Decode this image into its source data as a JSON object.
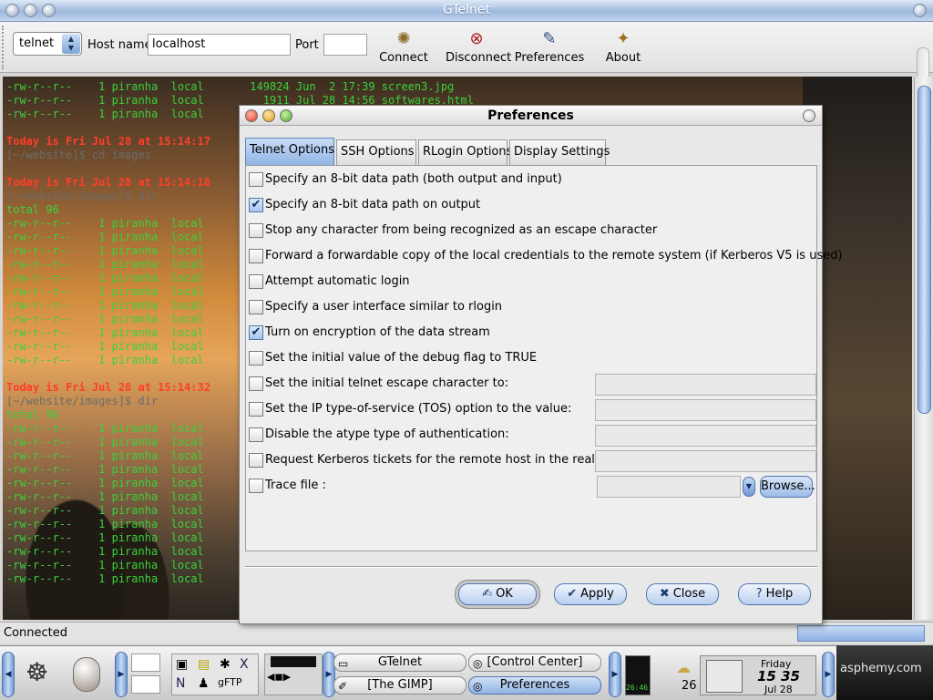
{
  "window": {
    "title": "GTelnet"
  },
  "toolbar": {
    "protocol": "telnet",
    "host_label": "Host name",
    "host_value": "localhost",
    "port_label": "Port",
    "port_value": "",
    "buttons": [
      {
        "label": "Connect",
        "icon": "connect-icon"
      },
      {
        "label": "Disconnect",
        "icon": "disconnect-icon"
      },
      {
        "label": "Preferences",
        "icon": "preferences-icon"
      },
      {
        "label": "About",
        "icon": "about-icon"
      }
    ]
  },
  "terminal": {
    "lines": [
      "-rw-r--r--    1 piranha  local       149824 Jun  2 17:39 screen3.jpg",
      "-rw-r--r--    1 piranha  local         1911 Jul 28 14:56 softwares.html",
      "-rw-r--r--    1 piranha  local",
      "",
      "Today is Fri Jul 28 at 15:14:17",
      "[~/website]$ cd images",
      "",
      "Today is Fri Jul 28 at 15:14:18",
      "[~/website/images]$ dir",
      "total 96",
      "-rw-r--r--    1 piranha  local",
      "-rw-r--r--    1 piranha  local",
      "-rw-r--r--    1 piranha  local",
      "-rw-r--r--    1 piranha  local",
      "-rw-r--r--    1 piranha  local",
      "-rw-r--r--    1 piranha  local",
      "-rw-r--r--    1 piranha  local",
      "-rw-r--r--    1 piranha  local",
      "-rw-r--r--    1 piranha  local",
      "-rw-r--r--    1 piranha  local",
      "-rw-r--r--    1 piranha  local",
      "",
      "Today is Fri Jul 28 at 15:14:32",
      "[~/website/images]$ dir",
      "total 96",
      "-rw-r--r--    1 piranha  local",
      "-rw-r--r--    1 piranha  local",
      "-rw-r--r--    1 piranha  local",
      "-rw-r--r--    1 piranha  local",
      "-rw-r--r--    1 piranha  local",
      "-rw-r--r--    1 piranha  local",
      "-rw-r--r--    1 piranha  local",
      "-rw-r--r--    1 piranha  local",
      "-rw-r--r--    1 piranha  local",
      "-rw-r--r--    1 piranha  local",
      "-rw-r--r--    1 piranha  local",
      "-rw-r--r--    1 piranha  local"
    ]
  },
  "status": {
    "text": "Connected"
  },
  "dialog": {
    "title": "Preferences",
    "tabs": [
      "Telnet Options",
      "SSH Options",
      "RLogin Options",
      "Display Settings"
    ],
    "active_tab": 0,
    "options": [
      {
        "label": "Specify an 8-bit data path (both output and input)",
        "checked": false
      },
      {
        "label": "Specify an 8-bit data path on output",
        "checked": true
      },
      {
        "label": "Stop any character from being  recognized as an escape character",
        "checked": false
      },
      {
        "label": "Forward a forwardable copy of the local credentials to the remote system (if Kerberos V5 is used)",
        "checked": false
      },
      {
        "label": "Attempt automatic login",
        "checked": false
      },
      {
        "label": "Specify a user interface similar to rlogin",
        "checked": false
      },
      {
        "label": "Turn on encryption of the data stream",
        "checked": true
      },
      {
        "label": "Set the initial value of the debug flag to TRUE",
        "checked": false
      },
      {
        "label": "Set  the initial telnet escape character to:",
        "checked": false,
        "field": ""
      },
      {
        "label": "Set the IP type-of-service  (TOS)  option  to the value:",
        "checked": false,
        "field": ""
      },
      {
        "label": "Disable the atype type of authentication:",
        "checked": false,
        "field": ""
      },
      {
        "label": "Request  Kerberos tickets for the remote host in the realm:",
        "checked": false,
        "field": ""
      },
      {
        "label": "Trace file :",
        "checked": false,
        "file": ""
      }
    ],
    "browse_label": "Browse...",
    "buttons": {
      "ok": "OK",
      "apply": "Apply",
      "close": "Close",
      "help": "Help"
    }
  },
  "taskbar": {
    "tasks": [
      {
        "label": "GTelnet",
        "active": false
      },
      {
        "label": "[Control Center]",
        "active": false
      },
      {
        "label": "[The GIMP]",
        "active": false
      },
      {
        "label": "Preferences",
        "active": true
      }
    ],
    "clock": {
      "day": "Friday",
      "time": "15 35",
      "date": "Jul 28"
    },
    "weather_temp": "26",
    "load_text": "26:46",
    "desktop_text": "asphemy.com"
  },
  "colors": {
    "terminal_green": "#39d23b",
    "terminal_red": "#ff3e2a",
    "accent_blue": "#8fb3e3"
  }
}
